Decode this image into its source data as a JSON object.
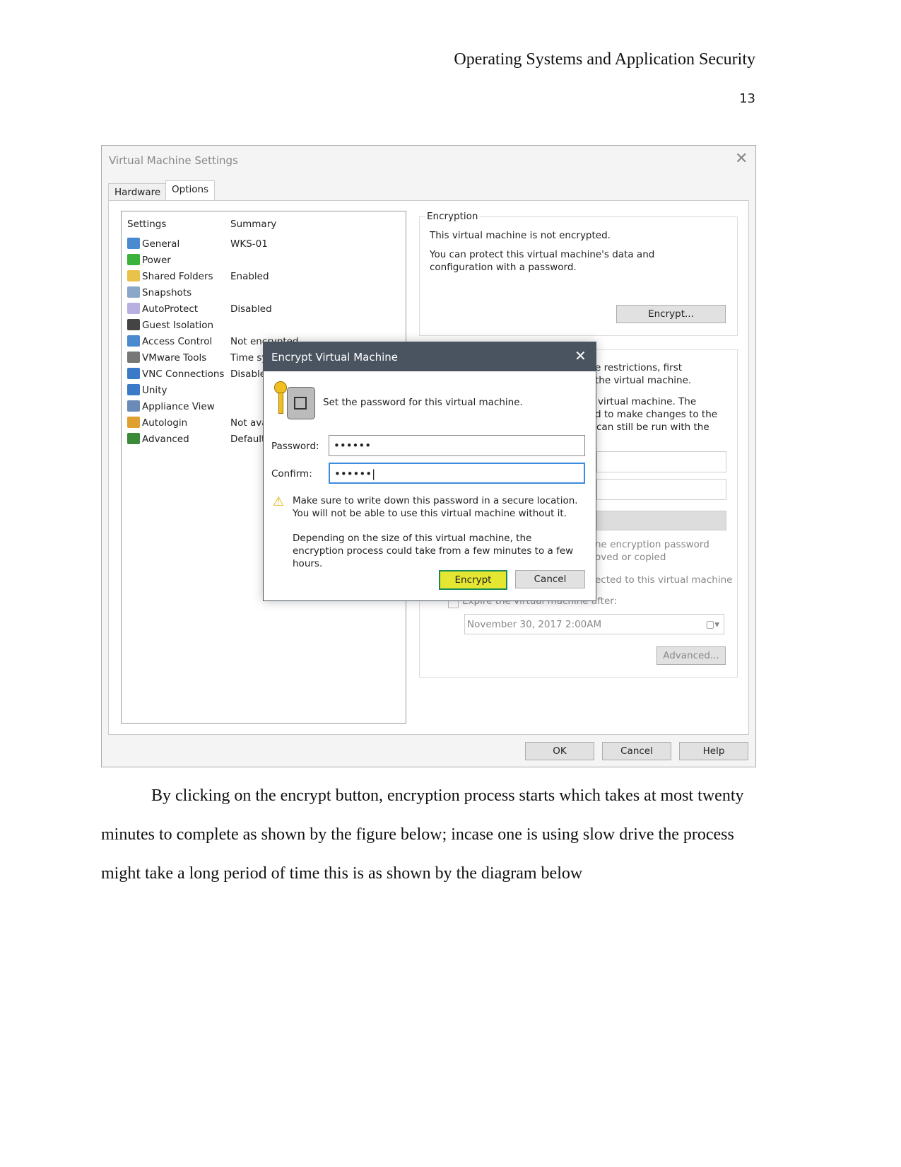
{
  "header": {
    "running_title": "Operating Systems and Application Security",
    "page_number": "13"
  },
  "window": {
    "title": "Virtual Machine Settings",
    "tabs": [
      "Hardware",
      "Options"
    ],
    "list_headers": {
      "settings": "Settings",
      "summary": "Summary"
    },
    "settings": [
      {
        "label": "General",
        "summary": "WKS-01",
        "icon": "monitor-icon",
        "color": "#4a8ad0"
      },
      {
        "label": "Power",
        "summary": "",
        "icon": "play-icon",
        "color": "#3bb33b"
      },
      {
        "label": "Shared Folders",
        "summary": "Enabled",
        "icon": "folder-icon",
        "color": "#e8c24a"
      },
      {
        "label": "Snapshots",
        "summary": "",
        "icon": "snapshot-icon",
        "color": "#8aa6c8"
      },
      {
        "label": "AutoProtect",
        "summary": "Disabled",
        "icon": "autoprotect-icon",
        "color": "#b8b0e0"
      },
      {
        "label": "Guest Isolation",
        "summary": "",
        "icon": "lock-icon",
        "color": "#444"
      },
      {
        "label": "Access Control",
        "summary": "Not encrypted",
        "icon": "access-control-icon",
        "color": "#4a8ad0"
      },
      {
        "label": "VMware Tools",
        "summary": "Time sy",
        "icon": "vm-icon",
        "color": "#777"
      },
      {
        "label": "VNC Connections",
        "summary": "Disable",
        "icon": "vnc-icon",
        "color": "#3a7ac8"
      },
      {
        "label": "Unity",
        "summary": "",
        "icon": "unity-icon",
        "color": "#3a7ac8"
      },
      {
        "label": "Appliance View",
        "summary": "",
        "icon": "appliance-icon",
        "color": "#6a8ab8"
      },
      {
        "label": "Autologin",
        "summary": "Not ava",
        "icon": "user-key-icon",
        "color": "#e0a030"
      },
      {
        "label": "Advanced",
        "summary": "Default",
        "icon": "advanced-icon",
        "color": "#3a8a3a"
      }
    ],
    "encryption": {
      "legend": "Encryption",
      "status": "This virtual machine is not encrypted.",
      "description": "You can protect this virtual machine's data and configuration with a password.",
      "button": "Encrypt..."
    },
    "access": {
      "line1": "e restrictions, first",
      "line2": "the virtual machine.",
      "line3": "virtual machine. The",
      "line4": "d to make changes to the",
      "line5": "can still be run with the",
      "line6": "ne encryption password",
      "line7": "oved or copied",
      "line8": "ected to this virtual machine",
      "expire_label": "Expire the virtual machine after:",
      "expire_date": "November 30, 2017   2:00AM",
      "advanced_button": "Advanced..."
    },
    "buttons": {
      "ok": "OK",
      "cancel": "Cancel",
      "help": "Help"
    }
  },
  "dialog": {
    "title": "Encrypt Virtual Machine",
    "prompt": "Set the password for this virtual machine.",
    "password_label": "Password:",
    "password_value": "••••••",
    "confirm_label": "Confirm:",
    "confirm_value": "••••••",
    "warning": "Make sure to write down this password in a secure location. You will not be able to use this virtual machine without it.",
    "note": "Depending on the size of this virtual machine, the encryption process could take from a few minutes to a few hours.",
    "encrypt_button": "Encrypt",
    "cancel_button": "Cancel",
    "highlight_color": "#e4e632"
  },
  "body": {
    "paragraph": [
      "By clicking on the encrypt button, encryption process starts which takes at most twenty",
      "minutes to complete as shown by the figure below; incase one is using slow drive the process",
      "might take a long period of time this is as shown by the diagram below"
    ]
  }
}
